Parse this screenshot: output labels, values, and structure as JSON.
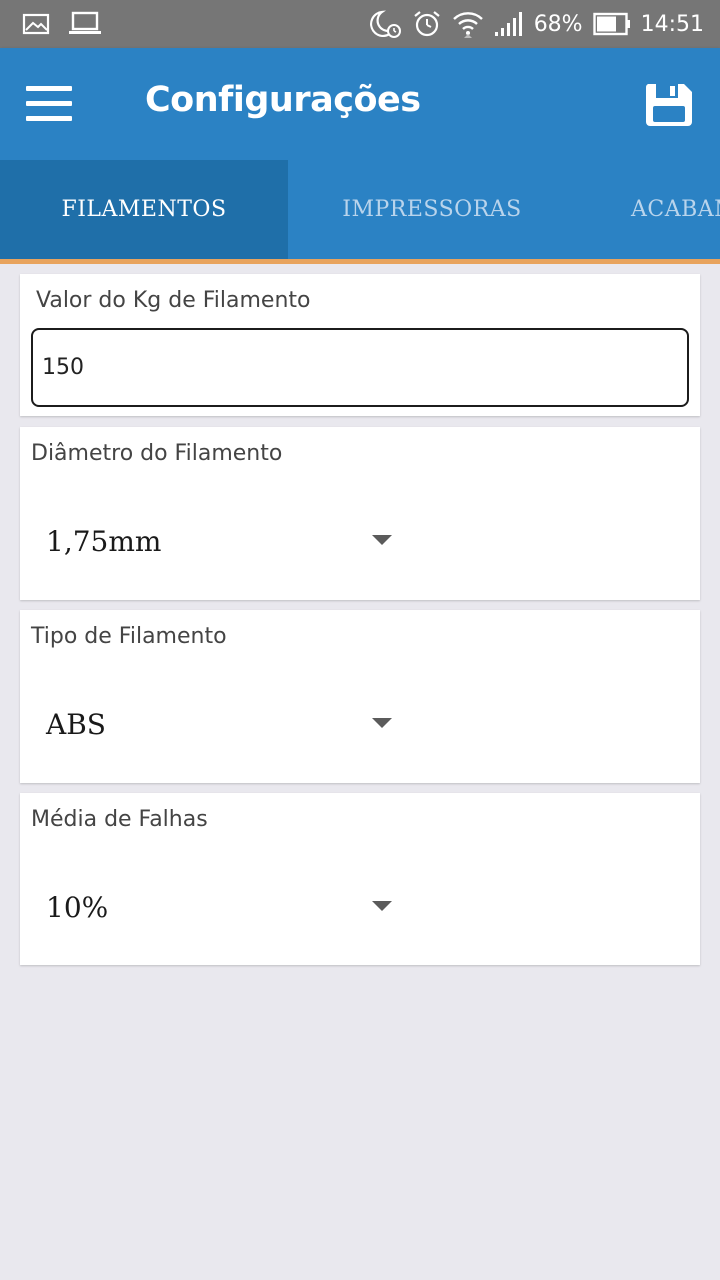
{
  "status_bar": {
    "battery": "68%",
    "time": "14:51",
    "icons": [
      "image-icon",
      "laptop-icon",
      "moon-alarm-icon",
      "alarm-icon",
      "wifi-icon",
      "signal-icon",
      "battery-icon"
    ]
  },
  "app_bar": {
    "title": "Configurações",
    "menu_icon": "hamburger-menu-icon",
    "save_icon": "floppy-save-icon"
  },
  "tabs": [
    {
      "label": "FILAMENTOS",
      "active": true
    },
    {
      "label": "IMPRESSORAS",
      "active": false
    },
    {
      "label": "ACABAM",
      "active": false
    }
  ],
  "form": {
    "kg_value": {
      "label": "Valor do Kg de Filamento",
      "value": "150"
    },
    "diameter": {
      "label": "Diâmetro do Filamento",
      "value": "1,75mm"
    },
    "type": {
      "label": "Tipo de Filamento",
      "value": "ABS"
    },
    "failures": {
      "label": "Média de Falhas",
      "value": "10%"
    }
  },
  "colors": {
    "primary": "#2b82c4",
    "tab_active": "#1f6fa9",
    "tab_indicator": "#e8a35d",
    "background": "#e9e8ee",
    "status_bar": "#767676"
  }
}
